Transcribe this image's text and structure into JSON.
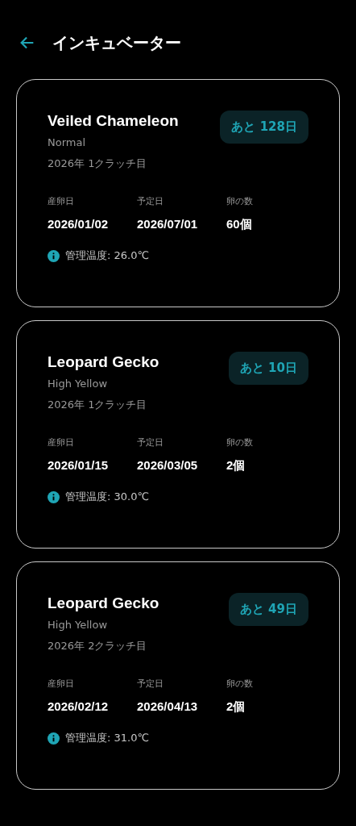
{
  "header": {
    "title": "インキュベーター"
  },
  "cards": [
    {
      "species": "Veiled Chameleon",
      "morph": "Normal",
      "clutch": "2026年 1クラッチ目",
      "badge": "あと 128日",
      "stats": [
        {
          "label": "産卵日",
          "value": "2026/01/02"
        },
        {
          "label": "予定日",
          "value": "2026/07/01"
        },
        {
          "label": "卵の数",
          "value": "60個"
        }
      ],
      "temperature": "管理温度: 26.0℃"
    },
    {
      "species": "Leopard Gecko",
      "morph": "High Yellow",
      "clutch": "2026年 1クラッチ目",
      "badge": "あと 10日",
      "stats": [
        {
          "label": "産卵日",
          "value": "2026/01/15"
        },
        {
          "label": "予定日",
          "value": "2026/03/05"
        },
        {
          "label": "卵の数",
          "value": "2個"
        }
      ],
      "temperature": "管理温度: 30.0℃"
    },
    {
      "species": "Leopard Gecko",
      "morph": "High Yellow",
      "clutch": "2026年 2クラッチ目",
      "badge": "あと 49日",
      "stats": [
        {
          "label": "産卵日",
          "value": "2026/02/12"
        },
        {
          "label": "予定日",
          "value": "2026/04/13"
        },
        {
          "label": "卵の数",
          "value": "2個"
        }
      ],
      "temperature": "管理温度: 31.0℃"
    }
  ]
}
